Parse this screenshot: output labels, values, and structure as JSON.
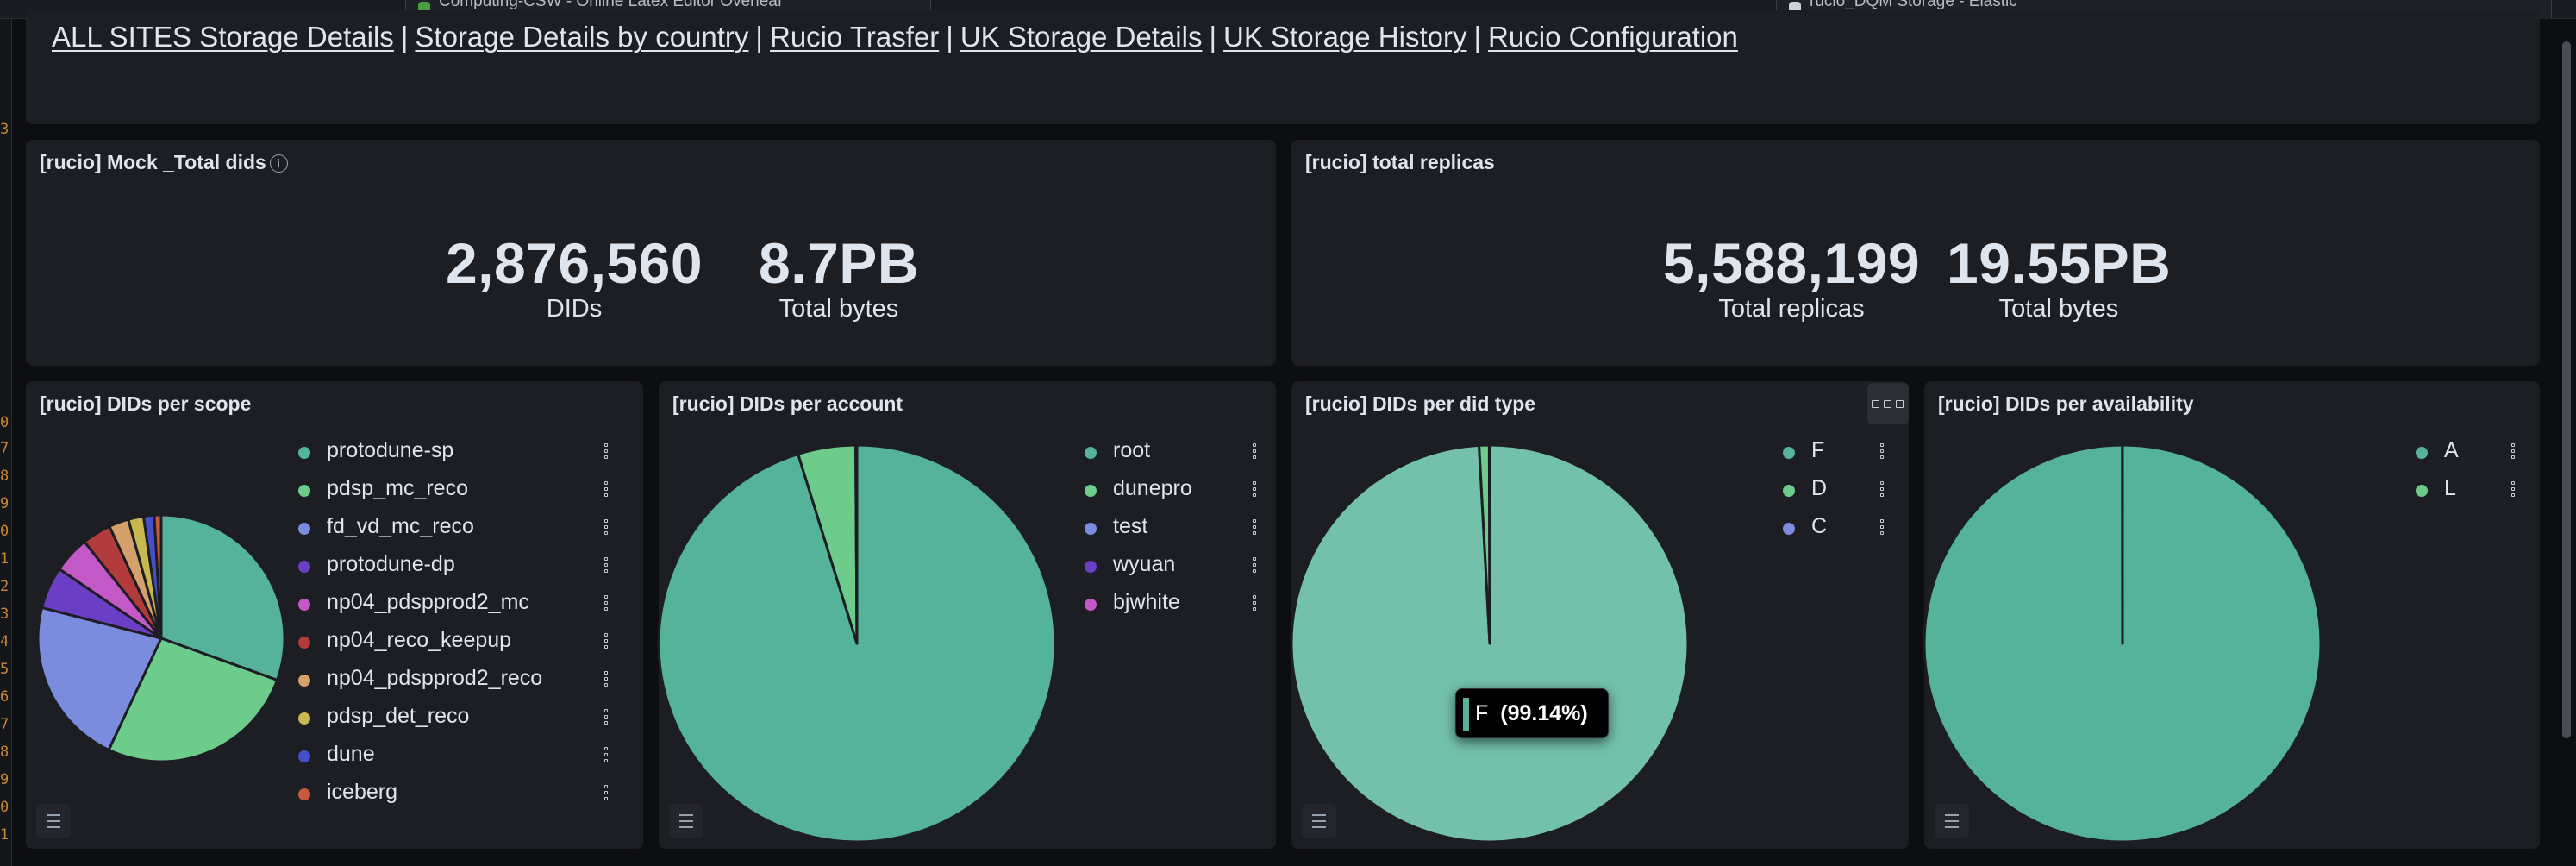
{
  "browser": {
    "tabs": [
      {
        "title": "Computing-CSW - Online Latex Editor Overleaf",
        "icon_color": "#47a141"
      },
      {
        "title": "rucio_DQM Storage - Elastic",
        "icon_color": "#d0d2d8"
      }
    ]
  },
  "nav": {
    "links": [
      "ALL SITES Storage Details",
      "Storage Details by country",
      "Rucio Trasfer",
      "UK Storage Details",
      "UK Storage History",
      "Rucio Configuration"
    ],
    "separator": "|"
  },
  "panels": {
    "total_dids": {
      "title": "[rucio] Mock _Total dids",
      "info_icon": "info-icon",
      "metrics": [
        {
          "value": "2,876,560",
          "label": "DIDs"
        },
        {
          "value": "8.7PB",
          "label": "Total bytes"
        }
      ]
    },
    "total_replicas": {
      "title": "[rucio] total replicas",
      "metrics": [
        {
          "value": "5,588,199",
          "label": "Total replicas"
        },
        {
          "value": "19.55PB",
          "label": "Total bytes"
        }
      ]
    },
    "dids_per_scope": {
      "title": "[rucio] DIDs per scope"
    },
    "dids_per_account": {
      "title": "[rucio] DIDs per account"
    },
    "dids_per_did_type": {
      "title": "[rucio] DIDs per did type",
      "tooltip": {
        "label": "F",
        "value": "(99.14%)"
      }
    },
    "dids_per_availability": {
      "title": "[rucio] DIDs per availability"
    }
  },
  "chart_data": [
    {
      "type": "pie",
      "title": "[rucio] DIDs per scope",
      "categories": [
        "protodune-sp",
        "pdsp_mc_reco",
        "fd_vd_mc_reco",
        "protodune-dp",
        "np04_pdspprod2_mc",
        "np04_reco_keepup",
        "np04_pdspprod2_reco",
        "pdsp_det_reco",
        "dune",
        "iceberg"
      ],
      "values": [
        30.5,
        26.5,
        22.0,
        5.5,
        4.8,
        3.8,
        2.6,
        2.0,
        1.4,
        0.9
      ],
      "colors": [
        "#54b399",
        "#6dcc8b",
        "#7b8cde",
        "#6a3fc6",
        "#c358c7",
        "#b23b3b",
        "#d4a06c",
        "#c9b84f",
        "#4550c8",
        "#c85a3c"
      ]
    },
    {
      "type": "pie",
      "title": "[rucio] DIDs per account",
      "categories": [
        "root",
        "dunepro",
        "test",
        "wyuan",
        "bjwhite"
      ],
      "values": [
        95.2,
        4.7,
        0.05,
        0.03,
        0.02
      ],
      "colors": [
        "#54b399",
        "#6dcc8b",
        "#7b8cde",
        "#6a3fc6",
        "#c358c7"
      ]
    },
    {
      "type": "pie",
      "title": "[rucio] DIDs per did type",
      "categories": [
        "F",
        "D",
        "C"
      ],
      "values": [
        99.14,
        0.82,
        0.04
      ],
      "colors": [
        "#54b399",
        "#6dcc8b",
        "#7b8cde"
      ]
    },
    {
      "type": "pie",
      "title": "[rucio] DIDs per availability",
      "categories": [
        "A",
        "L"
      ],
      "values": [
        99.99,
        0.01
      ],
      "colors": [
        "#54b399",
        "#6dcc8b"
      ]
    }
  ]
}
